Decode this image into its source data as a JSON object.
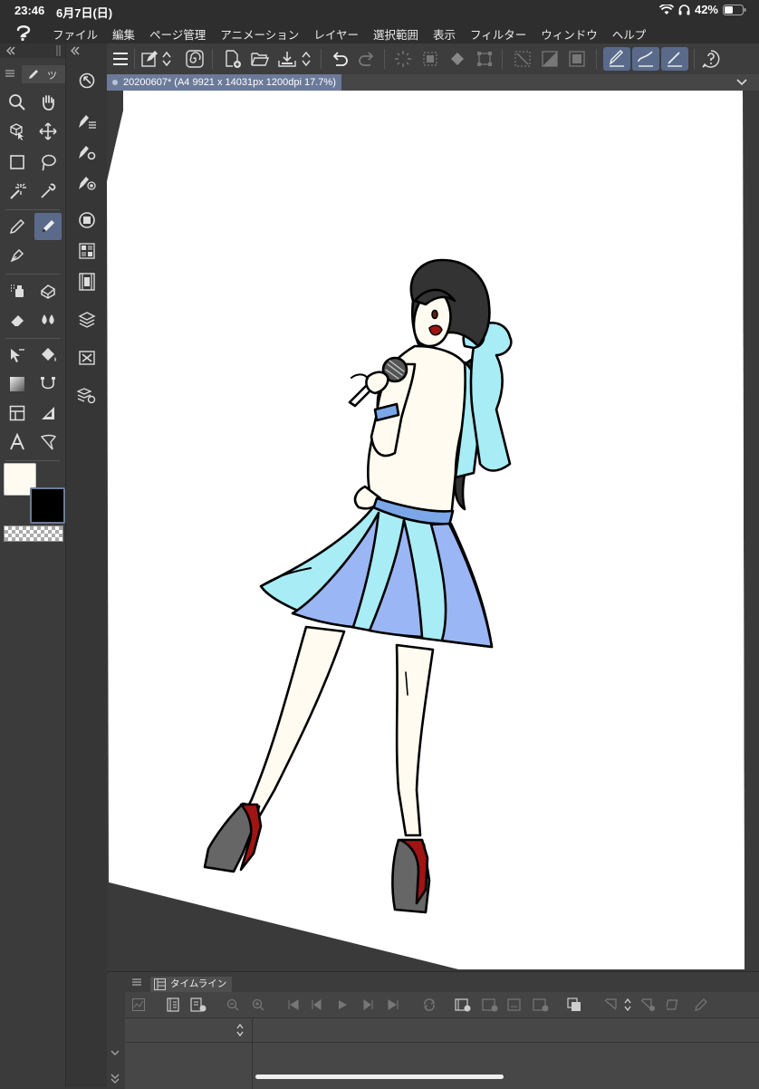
{
  "status": {
    "time": "23:46",
    "date": "6月7日(日)",
    "battery": "42%"
  },
  "menu": [
    "ファイル",
    "編集",
    "ページ管理",
    "アニメーション",
    "レイヤー",
    "選択範囲",
    "表示",
    "フィルター",
    "ウィンドウ",
    "ヘルプ"
  ],
  "panel_tab_label": "ツ",
  "document": {
    "tab_title": "20200607* (A4 9921 x 14031px 1200dpi 17.7%)"
  },
  "timeline": {
    "tab_label": "タイムライン"
  },
  "colors": {
    "main": "#fffbf0",
    "sub": "#000000",
    "accent": "#6c7a99"
  }
}
